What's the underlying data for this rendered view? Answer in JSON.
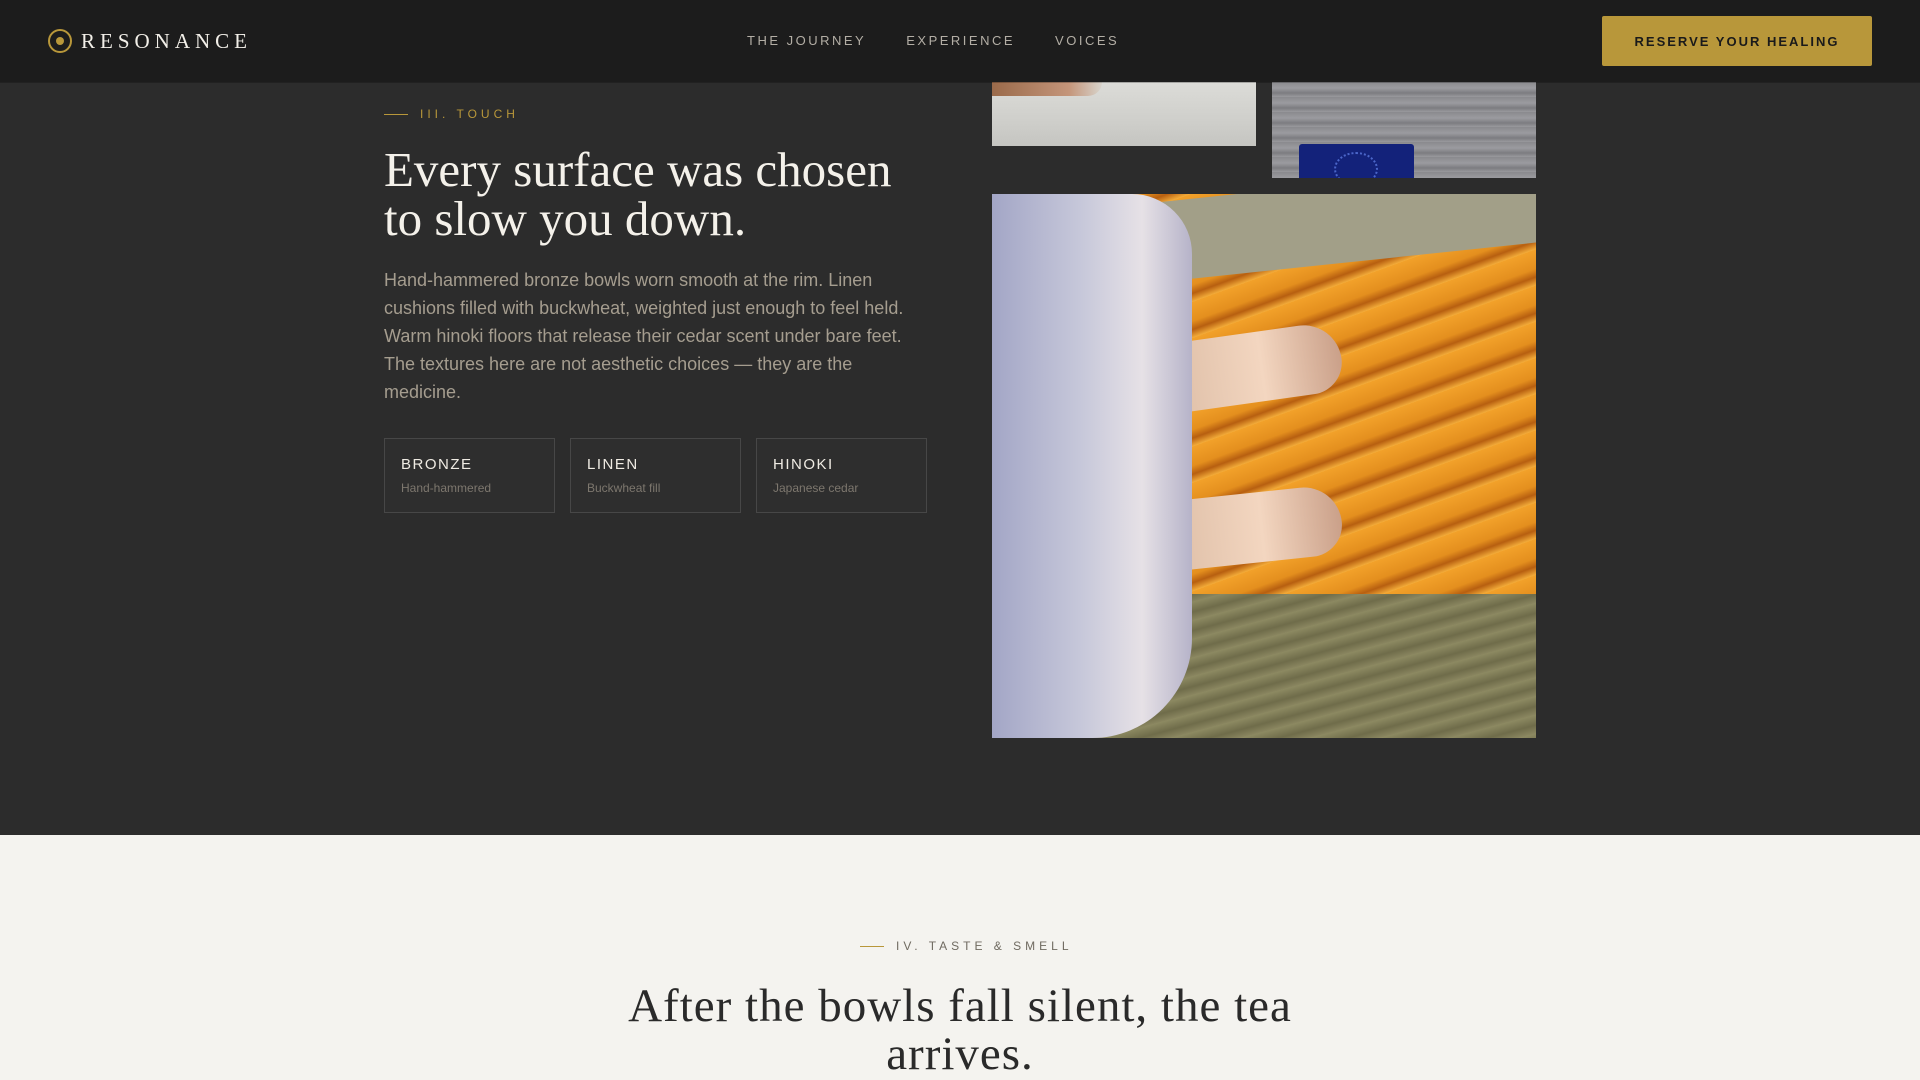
{
  "nav": {
    "brand": "RESONANCE",
    "links": [
      "THE JOURNEY",
      "EXPERIENCE",
      "VOICES"
    ],
    "cta": "RESERVE YOUR HEALING"
  },
  "touch": {
    "eyebrow": "III. TOUCH",
    "headline_line1": "Every surface was chosen",
    "headline_line2": "to slow you down.",
    "body": "Hand-hammered bronze bowls worn smooth at the rim. Linen cushions filled with buckwheat, weighted just enough to feel held. Warm hinoki floors that release their cedar scent under bare feet. The textures here are not aesthetic choices — they are the medicine.",
    "materials": [
      {
        "title": "BRONZE",
        "subtitle": "Hand-hammered"
      },
      {
        "title": "LINEN",
        "subtitle": "Buckwheat fill"
      },
      {
        "title": "HINOKI",
        "subtitle": "Japanese cedar"
      }
    ]
  },
  "taste": {
    "eyebrow": "IV. TASTE & SMELL",
    "headline_line1": "After the bowls fall silent, the tea",
    "headline_line2": "arrives."
  },
  "colors": {
    "accent": "#b8973a",
    "dark_bg": "#2c2c2c",
    "light_bg": "#f4f3ef"
  }
}
